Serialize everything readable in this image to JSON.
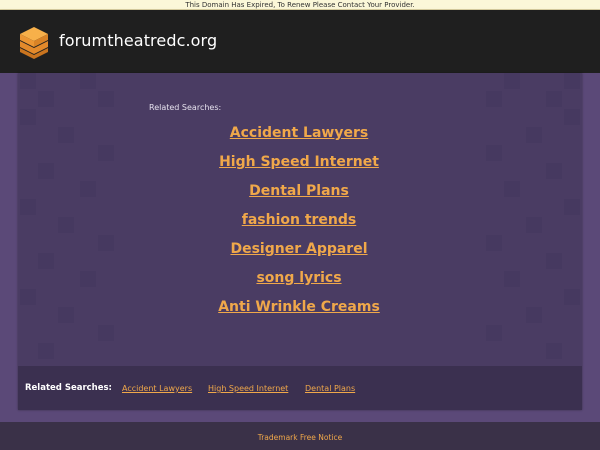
{
  "notice": "This Domain Has Expired, To Renew Please Contact Your Provider.",
  "header": {
    "domain": "forumtheatredc.org",
    "logo_icon": "layered-hex-logo-icon",
    "colors": {
      "logo_top": "#f7b04a",
      "logo_mid": "#f09a37",
      "logo_bottom": "#e7892d"
    }
  },
  "main": {
    "related_label": "Related Searches:",
    "links": [
      "Accident Lawyers",
      "High Speed Internet",
      "Dental Plans",
      "fashion trends",
      "Designer Apparel",
      "song lyrics",
      "Anti Wrinkle Creams"
    ]
  },
  "bottom_bar": {
    "title": "Related Searches:",
    "links": [
      "Accident Lawyers",
      "High Speed Internet",
      "Dental Plans"
    ]
  },
  "footer": {
    "link": "Trademark Free Notice"
  },
  "colors": {
    "accent": "#f0a84a",
    "panel": "#4a3c63",
    "header": "#1f1f1f"
  }
}
